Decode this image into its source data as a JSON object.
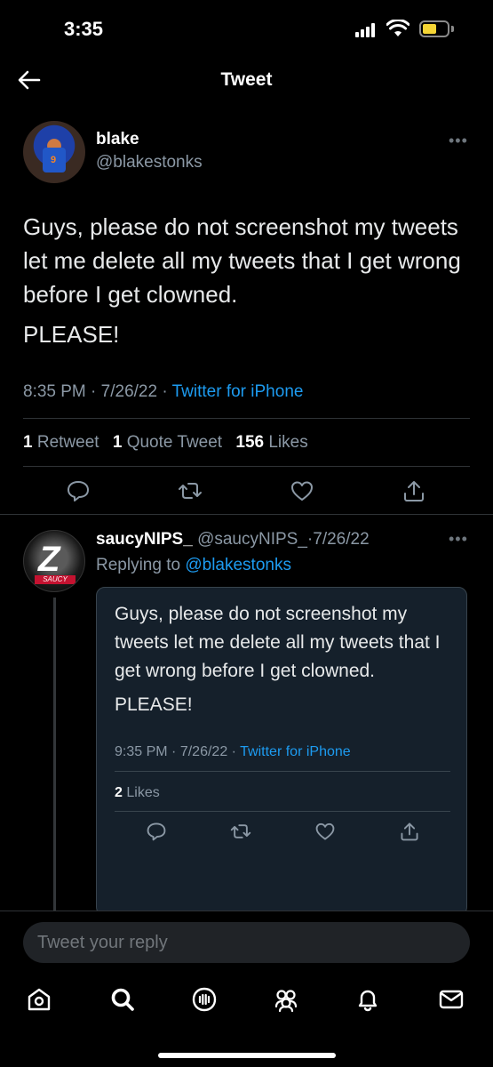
{
  "status_bar": {
    "time": "3:35",
    "battery_color": "#f5d535"
  },
  "nav": {
    "title": "Tweet",
    "back_icon": "arrow-left-icon"
  },
  "tweet": {
    "author_name": "blake",
    "author_handle": "@blakestonks",
    "avatar_jersey_number": "9",
    "text": "Guys, please do not screenshot my tweets let me delete all my tweets that I get wrong before I get clowned.",
    "text_line2": "PLEASE!",
    "time": "8:35 PM",
    "date": "7/26/22",
    "source": "Twitter for iPhone",
    "separator": "·",
    "stats": {
      "retweets_count": "1",
      "retweets_label": "Retweet",
      "quotes_count": "1",
      "quotes_label": "Quote Tweet",
      "likes_count": "156",
      "likes_label": "Likes"
    },
    "actions": [
      "reply-icon",
      "retweet-icon",
      "like-icon",
      "share-icon"
    ]
  },
  "reply": {
    "author_name": "saucyNIPS_",
    "author_handle": "@saucyNIPS_",
    "date": "7/26/22",
    "replying_prefix": "Replying to",
    "replying_to": "@blakestonks",
    "avatar_letter": "Z",
    "avatar_tag": "SAUCY",
    "quote": {
      "text": "Guys, please do not screenshot my tweets let me delete all my tweets that I get wrong before I get clowned.",
      "text_line2": "PLEASE!",
      "time": "9:35 PM",
      "date": "7/26/22",
      "source": "Twitter for iPhone",
      "likes_count": "2",
      "likes_label": "Likes"
    }
  },
  "composer": {
    "placeholder": "Tweet your reply"
  },
  "tab_bar": [
    "home-icon",
    "search-icon",
    "spaces-icon",
    "communities-icon",
    "notifications-icon",
    "messages-icon"
  ],
  "colors": {
    "accent": "#1d9bf0",
    "background": "#000000",
    "muted": "#8b98a5"
  }
}
